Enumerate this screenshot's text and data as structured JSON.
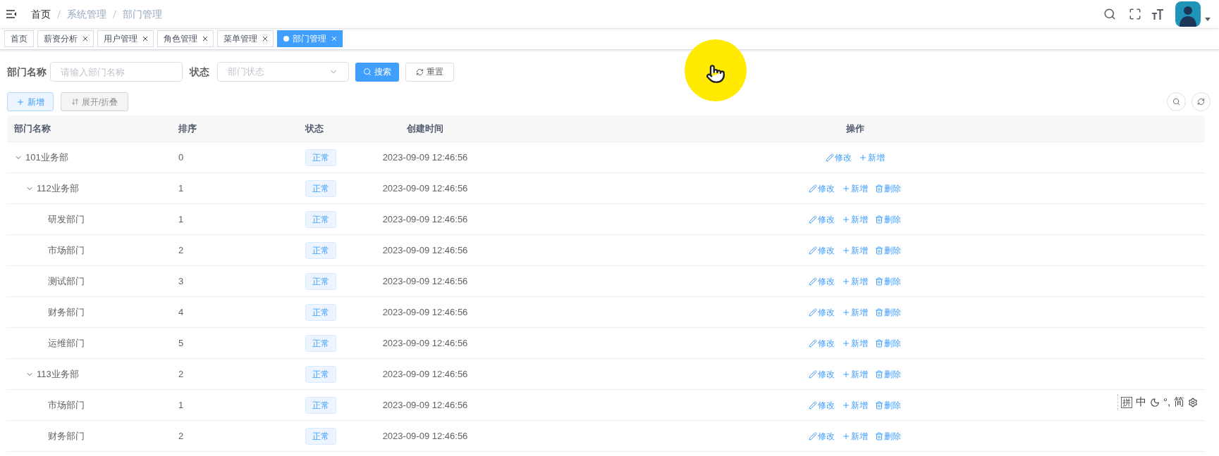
{
  "breadcrumb": [
    "首页",
    "系统管理",
    "部门管理"
  ],
  "tabs": [
    {
      "label": "首页",
      "closable": false,
      "selected": false
    },
    {
      "label": "薪资分析",
      "closable": true,
      "selected": false
    },
    {
      "label": "用户管理",
      "closable": true,
      "selected": false
    },
    {
      "label": "角色管理",
      "closable": true,
      "selected": false
    },
    {
      "label": "菜单管理",
      "closable": true,
      "selected": false
    },
    {
      "label": "部门管理",
      "closable": true,
      "selected": true
    }
  ],
  "search_form": {
    "name_label": "部门名称",
    "name_placeholder": "请输入部门名称",
    "status_label": "状态",
    "status_placeholder": "部门状态",
    "search_button": "搜索",
    "reset_button": "重置"
  },
  "toolbar": {
    "add_button": "新增",
    "expand_button": "展开/折叠"
  },
  "table": {
    "columns": [
      "部门名称",
      "排序",
      "状态",
      "创建时间",
      "操作"
    ],
    "rows": [
      {
        "name": "101业务部",
        "order": "0",
        "status": "正常",
        "created": "2023-09-09 12:46:56",
        "expanded": true,
        "actions": [
          {
            "kind": "edit",
            "label": "修改"
          },
          {
            "kind": "add",
            "label": "新增"
          }
        ],
        "children": [
          {
            "name": "112业务部",
            "order": "1",
            "status": "正常",
            "created": "2023-09-09 12:46:56",
            "expanded": true,
            "actions": [
              {
                "kind": "edit",
                "label": "修改"
              },
              {
                "kind": "add",
                "label": "新增"
              },
              {
                "kind": "delete",
                "label": "删除"
              }
            ],
            "children": [
              {
                "name": "研发部门",
                "order": "1",
                "status": "正常",
                "created": "2023-09-09 12:46:56",
                "actions": [
                  {
                    "kind": "edit",
                    "label": "修改"
                  },
                  {
                    "kind": "add",
                    "label": "新增"
                  },
                  {
                    "kind": "delete",
                    "label": "删除"
                  }
                ]
              },
              {
                "name": "市场部门",
                "order": "2",
                "status": "正常",
                "created": "2023-09-09 12:46:56",
                "actions": [
                  {
                    "kind": "edit",
                    "label": "修改"
                  },
                  {
                    "kind": "add",
                    "label": "新增"
                  },
                  {
                    "kind": "delete",
                    "label": "删除"
                  }
                ]
              },
              {
                "name": "测试部门",
                "order": "3",
                "status": "正常",
                "created": "2023-09-09 12:46:56",
                "actions": [
                  {
                    "kind": "edit",
                    "label": "修改"
                  },
                  {
                    "kind": "add",
                    "label": "新增"
                  },
                  {
                    "kind": "delete",
                    "label": "删除"
                  }
                ]
              },
              {
                "name": "财务部门",
                "order": "4",
                "status": "正常",
                "created": "2023-09-09 12:46:56",
                "actions": [
                  {
                    "kind": "edit",
                    "label": "修改"
                  },
                  {
                    "kind": "add",
                    "label": "新增"
                  },
                  {
                    "kind": "delete",
                    "label": "删除"
                  }
                ]
              },
              {
                "name": "运维部门",
                "order": "5",
                "status": "正常",
                "created": "2023-09-09 12:46:56",
                "actions": [
                  {
                    "kind": "edit",
                    "label": "修改"
                  },
                  {
                    "kind": "add",
                    "label": "新增"
                  },
                  {
                    "kind": "delete",
                    "label": "删除"
                  }
                ]
              }
            ]
          },
          {
            "name": "113业务部",
            "order": "2",
            "status": "正常",
            "created": "2023-09-09 12:46:56",
            "expanded": true,
            "actions": [
              {
                "kind": "edit",
                "label": "修改"
              },
              {
                "kind": "add",
                "label": "新增"
              },
              {
                "kind": "delete",
                "label": "删除"
              }
            ],
            "children": [
              {
                "name": "市场部门",
                "order": "1",
                "status": "正常",
                "created": "2023-09-09 12:46:56",
                "actions": [
                  {
                    "kind": "edit",
                    "label": "修改"
                  },
                  {
                    "kind": "add",
                    "label": "新增"
                  },
                  {
                    "kind": "delete",
                    "label": "删除"
                  }
                ]
              },
              {
                "name": "财务部门",
                "order": "2",
                "status": "正常",
                "created": "2023-09-09 12:46:56",
                "actions": [
                  {
                    "kind": "edit",
                    "label": "修改"
                  },
                  {
                    "kind": "add",
                    "label": "新增"
                  },
                  {
                    "kind": "delete",
                    "label": "删除"
                  }
                ]
              }
            ]
          }
        ]
      }
    ]
  },
  "ime_toolbar": [
    {
      "kind": "text",
      "label": "拼"
    },
    {
      "kind": "text",
      "label": "中"
    },
    {
      "kind": "moon"
    },
    {
      "kind": "text",
      "label": "°,"
    },
    {
      "kind": "text",
      "label": "简"
    },
    {
      "kind": "gear"
    }
  ]
}
